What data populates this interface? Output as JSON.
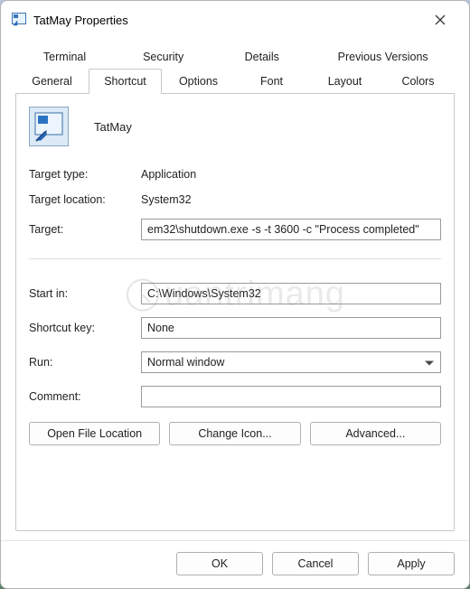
{
  "titlebar": {
    "title": "TatMay Properties"
  },
  "tabs": {
    "row1": [
      "Terminal",
      "Security",
      "Details",
      "Previous Versions"
    ],
    "row2": [
      "General",
      "Shortcut",
      "Options",
      "Font",
      "Layout",
      "Colors"
    ],
    "active": "Shortcut"
  },
  "header": {
    "name": "TatMay"
  },
  "labels": {
    "target_type": "Target type:",
    "target_location": "Target location:",
    "target": "Target:",
    "start_in": "Start in:",
    "shortcut_key": "Shortcut key:",
    "run": "Run:",
    "comment": "Comment:"
  },
  "values": {
    "target_type": "Application",
    "target_location": "System32",
    "target": "em32\\shutdown.exe -s -t 3600 -c \"Process completed\"",
    "start_in": "C:\\Windows\\System32",
    "shortcut_key": "None",
    "run": "Normal window",
    "comment": ""
  },
  "buttons": {
    "open_file_location": "Open File Location",
    "change_icon": "Change Icon...",
    "advanced": "Advanced..."
  },
  "footer": {
    "ok": "OK",
    "cancel": "Cancel",
    "apply": "Apply"
  },
  "watermark": "uantrimang"
}
